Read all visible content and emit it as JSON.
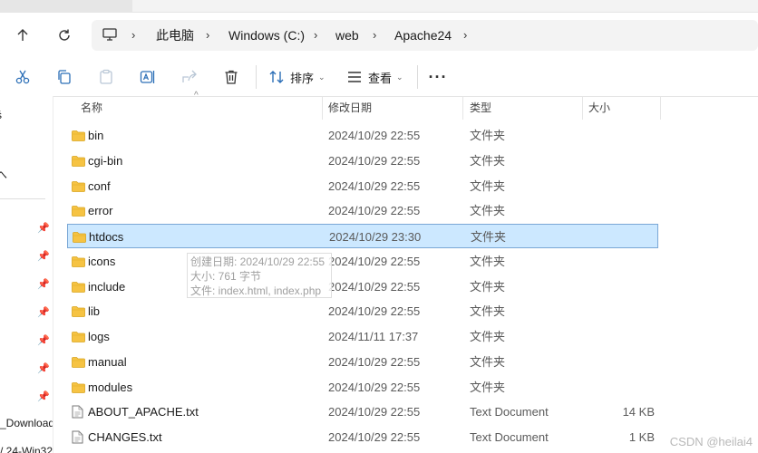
{
  "breadcrumb": [
    {
      "label": "此电脑"
    },
    {
      "label": "Windows (C:)"
    },
    {
      "label": "web"
    },
    {
      "label": "Apache24"
    }
  ],
  "toolbar": {
    "sort_label": "排序",
    "view_label": "查看"
  },
  "nav": {
    "partial_items": [
      "ś",
      "へ",
      "_Download",
      "/ 24-Win32"
    ]
  },
  "columns": {
    "name": "名称",
    "modified": "修改日期",
    "type": "类型",
    "size": "大小"
  },
  "files": [
    {
      "name": "bin",
      "modified": "2024/10/29 22:55",
      "type": "文件夹",
      "size": "",
      "kind": "folder"
    },
    {
      "name": "cgi-bin",
      "modified": "2024/10/29 22:55",
      "type": "文件夹",
      "size": "",
      "kind": "folder"
    },
    {
      "name": "conf",
      "modified": "2024/10/29 22:55",
      "type": "文件夹",
      "size": "",
      "kind": "folder"
    },
    {
      "name": "error",
      "modified": "2024/10/29 22:55",
      "type": "文件夹",
      "size": "",
      "kind": "folder"
    },
    {
      "name": "htdocs",
      "modified": "2024/10/29 23:30",
      "type": "文件夹",
      "size": "",
      "kind": "folder",
      "selected": true
    },
    {
      "name": "icons",
      "modified": "2024/10/29 22:55",
      "type": "文件夹",
      "size": "",
      "kind": "folder"
    },
    {
      "name": "include",
      "modified": "2024/10/29 22:55",
      "type": "文件夹",
      "size": "",
      "kind": "folder"
    },
    {
      "name": "lib",
      "modified": "2024/10/29 22:55",
      "type": "文件夹",
      "size": "",
      "kind": "folder"
    },
    {
      "name": "logs",
      "modified": "2024/11/11 17:37",
      "type": "文件夹",
      "size": "",
      "kind": "folder"
    },
    {
      "name": "manual",
      "modified": "2024/10/29 22:55",
      "type": "文件夹",
      "size": "",
      "kind": "folder"
    },
    {
      "name": "modules",
      "modified": "2024/10/29 22:55",
      "type": "文件夹",
      "size": "",
      "kind": "folder"
    },
    {
      "name": "ABOUT_APACHE.txt",
      "modified": "2024/10/29 22:55",
      "type": "Text Document",
      "size": "14 KB",
      "kind": "file"
    },
    {
      "name": "CHANGES.txt",
      "modified": "2024/10/29 22:55",
      "type": "Text Document",
      "size": "1 KB",
      "kind": "file"
    }
  ],
  "tooltip": {
    "created": "创建日期: 2024/10/29 22:55",
    "size": "大小: 761 字节",
    "files": "文件: index.html, index.php"
  },
  "watermark": "CSDN @heilai4",
  "colors": {
    "folder": "#f6c343",
    "selection_bg": "#cce8ff",
    "selection_border": "#7aa7d6"
  },
  "icons": [
    "back-arrow-icon",
    "refresh-icon",
    "computer-icon",
    "chevron-right-icon",
    "cut-icon",
    "copy-icon",
    "paste-icon",
    "rename-icon",
    "share-icon",
    "delete-icon",
    "sort-icon",
    "view-icon",
    "more-icon",
    "pin-icon",
    "folder-icon",
    "text-file-icon"
  ]
}
